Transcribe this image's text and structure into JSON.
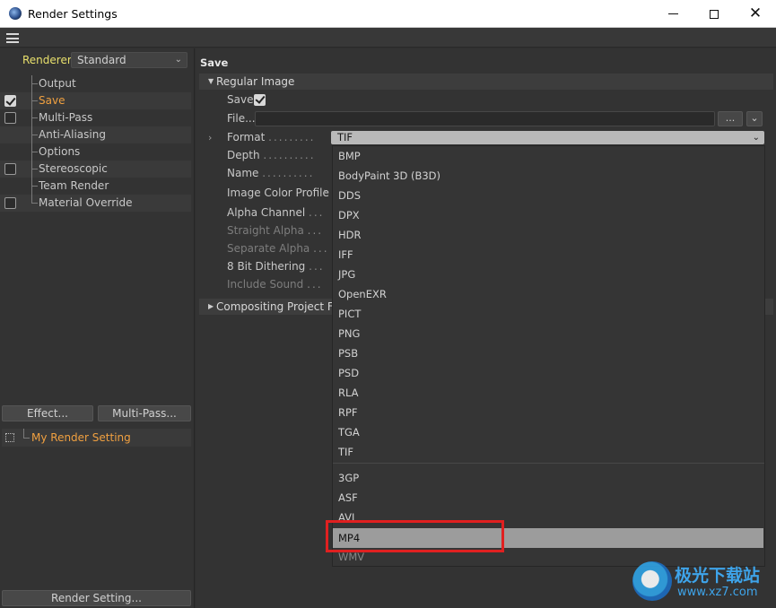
{
  "window": {
    "title": "Render Settings"
  },
  "left_panel": {
    "renderer_label": "Renderer",
    "renderer_value": "Standard",
    "tree": [
      {
        "label": "Output",
        "checkbox": false,
        "checked": false,
        "active": false
      },
      {
        "label": "Save",
        "checkbox": true,
        "checked": true,
        "active": true
      },
      {
        "label": "Multi-Pass",
        "checkbox": true,
        "checked": false,
        "active": false
      },
      {
        "label": "Anti-Aliasing",
        "checkbox": false,
        "checked": false,
        "active": false
      },
      {
        "label": "Options",
        "checkbox": false,
        "checked": false,
        "active": false
      },
      {
        "label": "Stereoscopic",
        "checkbox": true,
        "checked": false,
        "active": false
      },
      {
        "label": "Team Render",
        "checkbox": false,
        "checked": false,
        "active": false
      },
      {
        "label": "Material Override",
        "checkbox": true,
        "checked": false,
        "active": false
      }
    ],
    "effect_button": "Effect...",
    "multipass_button": "Multi-Pass...",
    "render_setting_name": "My Render Setting",
    "render_setting_button": "Render Setting..."
  },
  "right_panel": {
    "section_title": "Save",
    "group_regular": "Regular Image",
    "group_compositing": "Compositing Project File",
    "fields": {
      "save": "Save",
      "file": "File...",
      "format": "Format",
      "depth": "Depth",
      "name": "Name",
      "image_color_profile": "Image Color Profile",
      "alpha_channel": "Alpha Channel",
      "straight_alpha": "Straight Alpha",
      "separate_alpha": "Separate Alpha",
      "dithering": "8 Bit Dithering",
      "include_sound": "Include Sound"
    },
    "file_value": "",
    "browse_button": "...",
    "format_value": "TIF"
  },
  "dropdown": {
    "image_formats": [
      "BMP",
      "BodyPaint 3D (B3D)",
      "DDS",
      "DPX",
      "HDR",
      "IFF",
      "JPG",
      "OpenEXR",
      "PICT",
      "PNG",
      "PSB",
      "PSD",
      "RLA",
      "RPF",
      "TGA",
      "TIF"
    ],
    "movie_formats": [
      "3GP",
      "ASF",
      "AVI",
      "MP4",
      "WMV"
    ],
    "highlighted": "MP4"
  },
  "watermark": {
    "line1": "极光下载站",
    "line2": "www.xz7.com"
  },
  "colors": {
    "active_item": "#f0a040",
    "renderer_label": "#e8e06c",
    "highlight": "#9c9c9c",
    "annotation": "#e02020"
  }
}
